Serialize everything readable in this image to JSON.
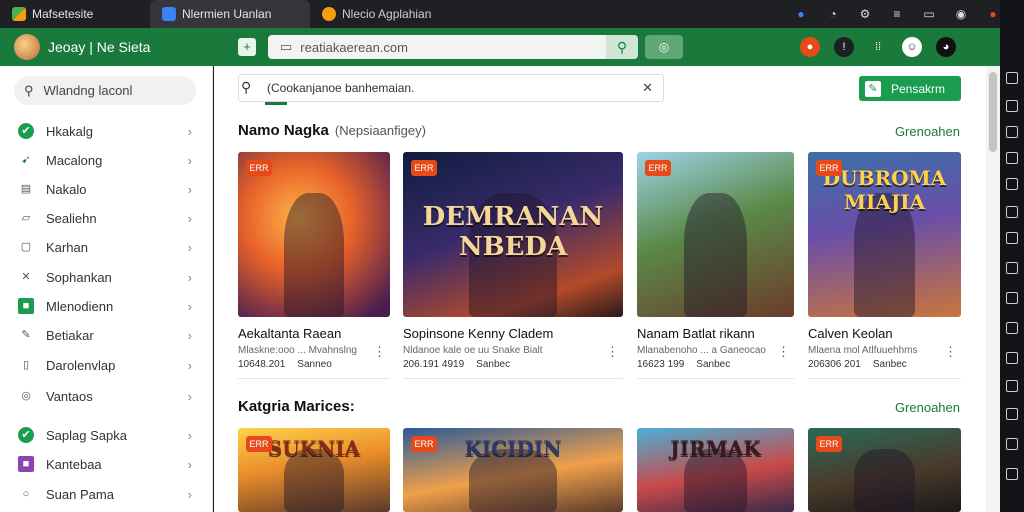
{
  "tabs": [
    {
      "label": "Mafsetesite",
      "favicon_color": "#4caf50"
    },
    {
      "label": "Nlermien Uanlan",
      "favicon_color": "#3b82f6"
    },
    {
      "label": "Nlecio Agplahian",
      "favicon_color": "#f59e0b"
    }
  ],
  "app": {
    "title": "Jeoay | Ne Sieta"
  },
  "url": {
    "value": "reatiakaerean.com",
    "go_icon": "search-icon",
    "extra": "◎"
  },
  "toolbar_icons": [
    "bell-icon",
    "info-icon",
    "grid-icon",
    "smile-icon",
    "user-icon"
  ],
  "sidebar": {
    "search_placeholder": "Wlandng laconl",
    "items": [
      {
        "label": "Hkakalg",
        "icon": "check-circle-icon",
        "color": "#1a9d4e"
      },
      {
        "label": "Macalong",
        "icon": "rocket-icon",
        "color": "#1a7a3c"
      },
      {
        "label": "Nakalo",
        "icon": "file-icon",
        "color": "#555"
      },
      {
        "label": "Sealiehn",
        "icon": "folder-icon",
        "color": "#555"
      },
      {
        "label": "Karhan",
        "icon": "box-icon",
        "color": "#555"
      },
      {
        "label": "Sophankan",
        "icon": "swords-icon",
        "color": "#555"
      },
      {
        "label": "Mlenodienn",
        "icon": "green-square-icon",
        "color": "#1a9d4e"
      },
      {
        "label": "Betiakar",
        "icon": "bookmark-icon",
        "color": "#555"
      },
      {
        "label": "Darolenvlap",
        "icon": "clipboard-icon",
        "color": "#555"
      },
      {
        "label": "Vantaos",
        "icon": "globe-icon",
        "color": "#555"
      },
      {
        "label": "Saplag Sapka",
        "icon": "check-circle-icon",
        "color": "#1a9d4e"
      },
      {
        "label": "Kantebaa",
        "icon": "purple-square-icon",
        "color": "#8e44ad"
      },
      {
        "label": "Suan Pama",
        "icon": "circle-icon",
        "color": "#555"
      }
    ]
  },
  "main": {
    "search_value": "(Cookanjanoe banhemaian.",
    "action_button": "Pensakrm",
    "sections": [
      {
        "title": "Namo Nagka",
        "subtitle": "(Nepsiaanfigey)",
        "link": "Grenoahen",
        "cards": [
          {
            "badge": "ERR",
            "title": "Aekaltanta Raean",
            "sub": "Mlaskne:ooo ... Mvahnslng",
            "meta1": "10648.201",
            "meta2": "Sanneo",
            "art": "hero",
            "art_text": ""
          },
          {
            "badge": "ERR",
            "title": "Sopinsone Kenny Cladem",
            "sub": "Nldanoe kale oe uu Snake Bialt",
            "meta1": "206.191 4919",
            "meta2": "Sanbec",
            "art": "city",
            "art_text": "DEMRANAN NBEDA"
          },
          {
            "badge": "ERR",
            "title": "Nanam Batlat rikann",
            "sub": "Mlanabenoho ... a Ganeocao",
            "meta1": "16623 199",
            "meta2": "Sanbec",
            "art": "soldier",
            "art_text": ""
          },
          {
            "badge": "ERR",
            "title": "Calven Keolan",
            "sub": "Mlaena mol Atlfuuehhms",
            "meta1": "206306 201",
            "meta2": "Sanbec",
            "art": "party",
            "art_text": "DUBROMA MIAJIA"
          }
        ]
      },
      {
        "title": "Katgria Marices:",
        "subtitle": "",
        "link": "Grenoahen",
        "cards": [
          {
            "badge": "ERR",
            "title": "",
            "sub": "",
            "meta1": "",
            "meta2": "",
            "art": "yellow",
            "art_text": "SUKNIA"
          },
          {
            "badge": "ERR",
            "title": "",
            "sub": "",
            "meta1": "",
            "meta2": "",
            "art": "blue",
            "art_text": "KICIDIN"
          },
          {
            "badge": "",
            "title": "",
            "sub": "",
            "meta1": "",
            "meta2": "",
            "art": "red",
            "art_text": "JIRMAK"
          },
          {
            "badge": "ERR",
            "title": "",
            "sub": "",
            "meta1": "",
            "meta2": "",
            "art": "armor",
            "art_text": ""
          }
        ]
      }
    ]
  }
}
